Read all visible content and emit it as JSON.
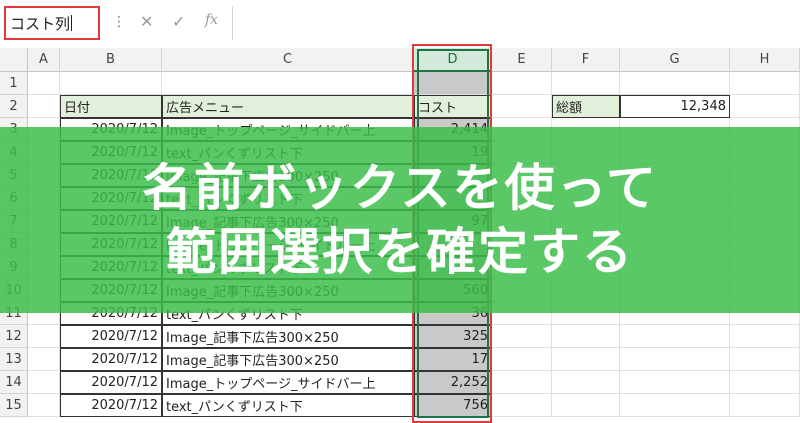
{
  "name_box": {
    "value": "コスト列"
  },
  "formula_bar": {
    "cancel_glyph": "✕",
    "enter_glyph": "✓",
    "fx_glyph": "fx",
    "dots_glyph": "⋮",
    "value": ""
  },
  "columns": [
    "A",
    "B",
    "C",
    "D",
    "E",
    "F",
    "G",
    "H"
  ],
  "selected_column": "D",
  "rows": [
    "1",
    "2",
    "3",
    "4",
    "5",
    "6",
    "7",
    "8",
    "9",
    "10",
    "11",
    "12",
    "13",
    "14",
    "15"
  ],
  "table": {
    "headers": {
      "date": "日付",
      "menu": "広告メニュー",
      "cost": "コスト"
    },
    "rows": [
      {
        "date": "2020/7/12",
        "menu": "Image_トップページ_サイドバー上",
        "cost": "2,414"
      },
      {
        "date": "2020/7/12",
        "menu": "text_パンくずリスト下",
        "cost": "19"
      },
      {
        "date": "2020/7/12",
        "menu": "Image_記事下広告300×250",
        "cost": ""
      },
      {
        "date": "2020/7/12",
        "menu": "text_パンくずリスト下",
        "cost": ""
      },
      {
        "date": "2020/7/12",
        "menu": "Image_記事下広告300×250",
        "cost": "97"
      },
      {
        "date": "2020/7/12",
        "menu": "Image_トップページ_サイドバー上",
        "cost": ""
      },
      {
        "date": "2020/7/12",
        "menu": "text_パンくずリスト下",
        "cost": ""
      },
      {
        "date": "2020/7/12",
        "menu": "Image_記事下広告300×250",
        "cost": "560"
      },
      {
        "date": "2020/7/12",
        "menu": "text_パンくずリスト下",
        "cost": "36"
      },
      {
        "date": "2020/7/12",
        "menu": "Image_記事下広告300×250",
        "cost": "325"
      },
      {
        "date": "2020/7/12",
        "menu": "Image_記事下広告300×250",
        "cost": "17"
      },
      {
        "date": "2020/7/12",
        "menu": "Image_トップページ_サイドバー上",
        "cost": "2,252"
      },
      {
        "date": "2020/7/12",
        "menu": "text_パンくずリスト下",
        "cost": "756"
      }
    ]
  },
  "summary": {
    "label": "総額",
    "value": "12,348"
  },
  "banner": {
    "line1": "名前ボックスを使って",
    "line2": "範囲選択を確定する"
  },
  "colors": {
    "highlight_red": "#e23a3a",
    "banner_green": "#3cbe4b",
    "excel_green": "#217346",
    "header_fill": "#e2efda"
  }
}
